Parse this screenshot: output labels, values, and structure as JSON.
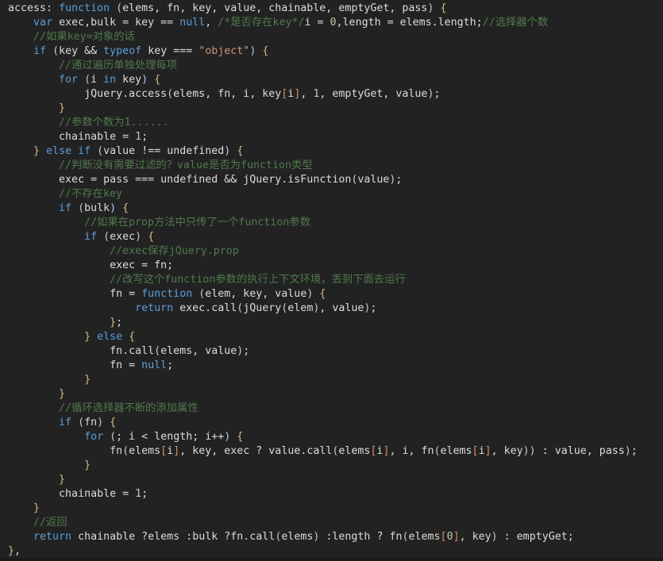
{
  "editor": {
    "background_color": "#222223",
    "font_size_px": 13.3,
    "line_height_px": 18,
    "language": "javascript",
    "colors": {
      "foreground": "#dcdcdc",
      "keyword": "#5b9ed6",
      "string": "#ce9178",
      "number": "#b5cea8",
      "comment": "#4f7a4a",
      "curly_brace": "#d7ba7d",
      "paren": "#bcc8e0",
      "bracket": "#d88b6a"
    }
  },
  "code": {
    "lines": [
      [
        {
          "t": "access",
          "c": "id"
        },
        {
          "t": ": ",
          "c": "punc"
        },
        {
          "t": "function",
          "c": "kw"
        },
        {
          "t": " ",
          "c": "punc"
        },
        {
          "t": "(",
          "c": "br2"
        },
        {
          "t": "elems, fn, key, value, chainable, emptyGet, pass",
          "c": "id"
        },
        {
          "t": ")",
          "c": "br2"
        },
        {
          "t": " ",
          "c": "punc"
        },
        {
          "t": "{",
          "c": "br1"
        }
      ],
      [
        {
          "t": "    ",
          "c": "punc"
        },
        {
          "t": "var",
          "c": "kw"
        },
        {
          "t": " exec,bulk ",
          "c": "id"
        },
        {
          "t": "=",
          "c": "op"
        },
        {
          "t": " key ",
          "c": "id"
        },
        {
          "t": "==",
          "c": "op"
        },
        {
          "t": " ",
          "c": "punc"
        },
        {
          "t": "null",
          "c": "kw"
        },
        {
          "t": ", ",
          "c": "punc"
        },
        {
          "t": "/*是否存在key*/",
          "c": "cmt"
        },
        {
          "t": "i ",
          "c": "id"
        },
        {
          "t": "=",
          "c": "op"
        },
        {
          "t": " ",
          "c": "punc"
        },
        {
          "t": "0",
          "c": "num"
        },
        {
          "t": ",length ",
          "c": "id"
        },
        {
          "t": "=",
          "c": "op"
        },
        {
          "t": " elems.length;",
          "c": "id"
        },
        {
          "t": "//选择器个数",
          "c": "cmt"
        }
      ],
      [
        {
          "t": "    ",
          "c": "punc"
        },
        {
          "t": "//如果key=对象的话",
          "c": "cmt"
        }
      ],
      [
        {
          "t": "    ",
          "c": "punc"
        },
        {
          "t": "if",
          "c": "kw"
        },
        {
          "t": " ",
          "c": "punc"
        },
        {
          "t": "(",
          "c": "br2"
        },
        {
          "t": "key ",
          "c": "id"
        },
        {
          "t": "&&",
          "c": "op"
        },
        {
          "t": " ",
          "c": "punc"
        },
        {
          "t": "typeof",
          "c": "kw"
        },
        {
          "t": " key ",
          "c": "id"
        },
        {
          "t": "===",
          "c": "op"
        },
        {
          "t": " ",
          "c": "punc"
        },
        {
          "t": "\"object\"",
          "c": "str"
        },
        {
          "t": ")",
          "c": "br2"
        },
        {
          "t": " ",
          "c": "punc"
        },
        {
          "t": "{",
          "c": "br1"
        }
      ],
      [
        {
          "t": "        ",
          "c": "punc"
        },
        {
          "t": "//通过遍历单独处理每项",
          "c": "cmt"
        }
      ],
      [
        {
          "t": "        ",
          "c": "punc"
        },
        {
          "t": "for",
          "c": "kw"
        },
        {
          "t": " ",
          "c": "punc"
        },
        {
          "t": "(",
          "c": "br2"
        },
        {
          "t": "i ",
          "c": "id"
        },
        {
          "t": "in",
          "c": "kw"
        },
        {
          "t": " key",
          "c": "id"
        },
        {
          "t": ")",
          "c": "br2"
        },
        {
          "t": " ",
          "c": "punc"
        },
        {
          "t": "{",
          "c": "br1"
        }
      ],
      [
        {
          "t": "            ",
          "c": "punc"
        },
        {
          "t": "jQuery.access",
          "c": "id"
        },
        {
          "t": "(",
          "c": "br2"
        },
        {
          "t": "elems, fn, i, key",
          "c": "id"
        },
        {
          "t": "[",
          "c": "br3"
        },
        {
          "t": "i",
          "c": "id"
        },
        {
          "t": "]",
          "c": "br3"
        },
        {
          "t": ", ",
          "c": "punc"
        },
        {
          "t": "1",
          "c": "num"
        },
        {
          "t": ", emptyGet, value",
          "c": "id"
        },
        {
          "t": ")",
          "c": "br2"
        },
        {
          "t": ";",
          "c": "punc"
        }
      ],
      [
        {
          "t": "        ",
          "c": "punc"
        },
        {
          "t": "}",
          "c": "br1"
        }
      ],
      [
        {
          "t": "        ",
          "c": "punc"
        },
        {
          "t": "//参数个数为1......",
          "c": "cmt"
        }
      ],
      [
        {
          "t": "        ",
          "c": "punc"
        },
        {
          "t": "chainable ",
          "c": "id"
        },
        {
          "t": "=",
          "c": "op"
        },
        {
          "t": " ",
          "c": "punc"
        },
        {
          "t": "1",
          "c": "num"
        },
        {
          "t": ";",
          "c": "punc"
        }
      ],
      [
        {
          "t": "    ",
          "c": "punc"
        },
        {
          "t": "}",
          "c": "br1"
        },
        {
          "t": " ",
          "c": "punc"
        },
        {
          "t": "else",
          "c": "kw"
        },
        {
          "t": " ",
          "c": "punc"
        },
        {
          "t": "if",
          "c": "kw"
        },
        {
          "t": " ",
          "c": "punc"
        },
        {
          "t": "(",
          "c": "br2"
        },
        {
          "t": "value ",
          "c": "id"
        },
        {
          "t": "!==",
          "c": "op"
        },
        {
          "t": " undefined",
          "c": "id"
        },
        {
          "t": ")",
          "c": "br2"
        },
        {
          "t": " ",
          "c": "punc"
        },
        {
          "t": "{",
          "c": "br1"
        }
      ],
      [
        {
          "t": "        ",
          "c": "punc"
        },
        {
          "t": "//判断没有需要过滤的？value是否为function类型",
          "c": "cmt"
        }
      ],
      [
        {
          "t": "        ",
          "c": "punc"
        },
        {
          "t": "exec ",
          "c": "id"
        },
        {
          "t": "=",
          "c": "op"
        },
        {
          "t": " pass ",
          "c": "id"
        },
        {
          "t": "===",
          "c": "op"
        },
        {
          "t": " undefined ",
          "c": "id"
        },
        {
          "t": "&&",
          "c": "op"
        },
        {
          "t": " jQuery.isFunction",
          "c": "id"
        },
        {
          "t": "(",
          "c": "br2"
        },
        {
          "t": "value",
          "c": "id"
        },
        {
          "t": ")",
          "c": "br2"
        },
        {
          "t": ";",
          "c": "punc"
        }
      ],
      [
        {
          "t": "        ",
          "c": "punc"
        },
        {
          "t": "//不存在key",
          "c": "cmt"
        }
      ],
      [
        {
          "t": "        ",
          "c": "punc"
        },
        {
          "t": "if",
          "c": "kw"
        },
        {
          "t": " ",
          "c": "punc"
        },
        {
          "t": "(",
          "c": "br2"
        },
        {
          "t": "bulk",
          "c": "id"
        },
        {
          "t": ")",
          "c": "br2"
        },
        {
          "t": " ",
          "c": "punc"
        },
        {
          "t": "{",
          "c": "br1"
        }
      ],
      [
        {
          "t": "            ",
          "c": "punc"
        },
        {
          "t": "//如果在prop方法中只传了一个function参数",
          "c": "cmt"
        }
      ],
      [
        {
          "t": "            ",
          "c": "punc"
        },
        {
          "t": "if",
          "c": "kw"
        },
        {
          "t": " ",
          "c": "punc"
        },
        {
          "t": "(",
          "c": "br2"
        },
        {
          "t": "exec",
          "c": "id"
        },
        {
          "t": ")",
          "c": "br2"
        },
        {
          "t": " ",
          "c": "punc"
        },
        {
          "t": "{",
          "c": "br1"
        }
      ],
      [
        {
          "t": "                ",
          "c": "punc"
        },
        {
          "t": "//exec保存jQuery.prop",
          "c": "cmt"
        }
      ],
      [
        {
          "t": "                ",
          "c": "punc"
        },
        {
          "t": "exec ",
          "c": "id"
        },
        {
          "t": "=",
          "c": "op"
        },
        {
          "t": " fn;",
          "c": "id"
        }
      ],
      [
        {
          "t": "                ",
          "c": "punc"
        },
        {
          "t": "//改写这个function参数的执行上下文环境，丢到下面去运行",
          "c": "cmt"
        }
      ],
      [
        {
          "t": "                ",
          "c": "punc"
        },
        {
          "t": "fn ",
          "c": "id"
        },
        {
          "t": "=",
          "c": "op"
        },
        {
          "t": " ",
          "c": "punc"
        },
        {
          "t": "function",
          "c": "kw"
        },
        {
          "t": " ",
          "c": "punc"
        },
        {
          "t": "(",
          "c": "br2"
        },
        {
          "t": "elem, key, value",
          "c": "id"
        },
        {
          "t": ")",
          "c": "br2"
        },
        {
          "t": " ",
          "c": "punc"
        },
        {
          "t": "{",
          "c": "br1"
        }
      ],
      [
        {
          "t": "                    ",
          "c": "punc"
        },
        {
          "t": "return",
          "c": "kw"
        },
        {
          "t": " exec.call",
          "c": "id"
        },
        {
          "t": "(",
          "c": "br2"
        },
        {
          "t": "jQuery",
          "c": "id"
        },
        {
          "t": "(",
          "c": "br2"
        },
        {
          "t": "elem",
          "c": "id"
        },
        {
          "t": ")",
          "c": "br2"
        },
        {
          "t": ", value",
          "c": "id"
        },
        {
          "t": ")",
          "c": "br2"
        },
        {
          "t": ";",
          "c": "punc"
        }
      ],
      [
        {
          "t": "                ",
          "c": "punc"
        },
        {
          "t": "}",
          "c": "br1"
        },
        {
          "t": ";",
          "c": "punc"
        }
      ],
      [
        {
          "t": "            ",
          "c": "punc"
        },
        {
          "t": "}",
          "c": "br1"
        },
        {
          "t": " ",
          "c": "punc"
        },
        {
          "t": "else",
          "c": "kw"
        },
        {
          "t": " ",
          "c": "punc"
        },
        {
          "t": "{",
          "c": "br1"
        }
      ],
      [
        {
          "t": "                ",
          "c": "punc"
        },
        {
          "t": "fn.call",
          "c": "id"
        },
        {
          "t": "(",
          "c": "br2"
        },
        {
          "t": "elems, value",
          "c": "id"
        },
        {
          "t": ")",
          "c": "br2"
        },
        {
          "t": ";",
          "c": "punc"
        }
      ],
      [
        {
          "t": "                ",
          "c": "punc"
        },
        {
          "t": "fn ",
          "c": "id"
        },
        {
          "t": "=",
          "c": "op"
        },
        {
          "t": " ",
          "c": "punc"
        },
        {
          "t": "null",
          "c": "kw"
        },
        {
          "t": ";",
          "c": "punc"
        }
      ],
      [
        {
          "t": "            ",
          "c": "punc"
        },
        {
          "t": "}",
          "c": "br1"
        }
      ],
      [
        {
          "t": "        ",
          "c": "punc"
        },
        {
          "t": "}",
          "c": "br1"
        }
      ],
      [
        {
          "t": "        ",
          "c": "punc"
        },
        {
          "t": "//循环选择器不断的添加属性",
          "c": "cmt"
        }
      ],
      [
        {
          "t": "        ",
          "c": "punc"
        },
        {
          "t": "if",
          "c": "kw"
        },
        {
          "t": " ",
          "c": "punc"
        },
        {
          "t": "(",
          "c": "br2"
        },
        {
          "t": "fn",
          "c": "id"
        },
        {
          "t": ")",
          "c": "br2"
        },
        {
          "t": " ",
          "c": "punc"
        },
        {
          "t": "{",
          "c": "br1"
        }
      ],
      [
        {
          "t": "            ",
          "c": "punc"
        },
        {
          "t": "for",
          "c": "kw"
        },
        {
          "t": " ",
          "c": "punc"
        },
        {
          "t": "(",
          "c": "br2"
        },
        {
          "t": "; i ",
          "c": "id"
        },
        {
          "t": "<",
          "c": "op"
        },
        {
          "t": " length; i",
          "c": "id"
        },
        {
          "t": "++",
          "c": "op"
        },
        {
          "t": ")",
          "c": "br2"
        },
        {
          "t": " ",
          "c": "punc"
        },
        {
          "t": "{",
          "c": "br1"
        }
      ],
      [
        {
          "t": "                ",
          "c": "punc"
        },
        {
          "t": "fn",
          "c": "id"
        },
        {
          "t": "(",
          "c": "br2"
        },
        {
          "t": "elems",
          "c": "id"
        },
        {
          "t": "[",
          "c": "br3"
        },
        {
          "t": "i",
          "c": "id"
        },
        {
          "t": "]",
          "c": "br3"
        },
        {
          "t": ", key, exec ",
          "c": "id"
        },
        {
          "t": "?",
          "c": "op"
        },
        {
          "t": " value.call",
          "c": "id"
        },
        {
          "t": "(",
          "c": "br2"
        },
        {
          "t": "elems",
          "c": "id"
        },
        {
          "t": "[",
          "c": "br3"
        },
        {
          "t": "i",
          "c": "id"
        },
        {
          "t": "]",
          "c": "br3"
        },
        {
          "t": ", i, fn",
          "c": "id"
        },
        {
          "t": "(",
          "c": "br2"
        },
        {
          "t": "elems",
          "c": "id"
        },
        {
          "t": "[",
          "c": "br3"
        },
        {
          "t": "i",
          "c": "id"
        },
        {
          "t": "]",
          "c": "br3"
        },
        {
          "t": ", key",
          "c": "id"
        },
        {
          "t": ")",
          "c": "br2"
        },
        {
          "t": ")",
          "c": "br2"
        },
        {
          "t": " ",
          "c": "punc"
        },
        {
          "t": ":",
          "c": "op"
        },
        {
          "t": " value, pass",
          "c": "id"
        },
        {
          "t": ")",
          "c": "br2"
        },
        {
          "t": ";",
          "c": "punc"
        }
      ],
      [
        {
          "t": "            ",
          "c": "punc"
        },
        {
          "t": "}",
          "c": "br1"
        }
      ],
      [
        {
          "t": "        ",
          "c": "punc"
        },
        {
          "t": "}",
          "c": "br1"
        }
      ],
      [
        {
          "t": "        ",
          "c": "punc"
        },
        {
          "t": "chainable ",
          "c": "id"
        },
        {
          "t": "=",
          "c": "op"
        },
        {
          "t": " ",
          "c": "punc"
        },
        {
          "t": "1",
          "c": "num"
        },
        {
          "t": ";",
          "c": "punc"
        }
      ],
      [
        {
          "t": "    ",
          "c": "punc"
        },
        {
          "t": "}",
          "c": "br1"
        }
      ],
      [
        {
          "t": "    ",
          "c": "punc"
        },
        {
          "t": "//返回",
          "c": "cmt"
        }
      ],
      [
        {
          "t": "    ",
          "c": "punc"
        },
        {
          "t": "return",
          "c": "kw"
        },
        {
          "t": " chainable ",
          "c": "id"
        },
        {
          "t": "?",
          "c": "op"
        },
        {
          "t": "elems ",
          "c": "id"
        },
        {
          "t": ":",
          "c": "op"
        },
        {
          "t": "bulk ",
          "c": "id"
        },
        {
          "t": "?",
          "c": "op"
        },
        {
          "t": "fn.call",
          "c": "id"
        },
        {
          "t": "(",
          "c": "br2"
        },
        {
          "t": "elems",
          "c": "id"
        },
        {
          "t": ")",
          "c": "br2"
        },
        {
          "t": " ",
          "c": "punc"
        },
        {
          "t": ":",
          "c": "op"
        },
        {
          "t": "length ",
          "c": "id"
        },
        {
          "t": "?",
          "c": "op"
        },
        {
          "t": " fn",
          "c": "id"
        },
        {
          "t": "(",
          "c": "br2"
        },
        {
          "t": "elems",
          "c": "id"
        },
        {
          "t": "[",
          "c": "br3"
        },
        {
          "t": "0",
          "c": "num"
        },
        {
          "t": "]",
          "c": "br3"
        },
        {
          "t": ", key",
          "c": "id"
        },
        {
          "t": ")",
          "c": "br2"
        },
        {
          "t": " ",
          "c": "punc"
        },
        {
          "t": ":",
          "c": "op"
        },
        {
          "t": " emptyGet;",
          "c": "id"
        }
      ],
      [
        {
          "t": "}",
          "c": "br1"
        },
        {
          "t": ",",
          "c": "punc"
        }
      ]
    ]
  }
}
